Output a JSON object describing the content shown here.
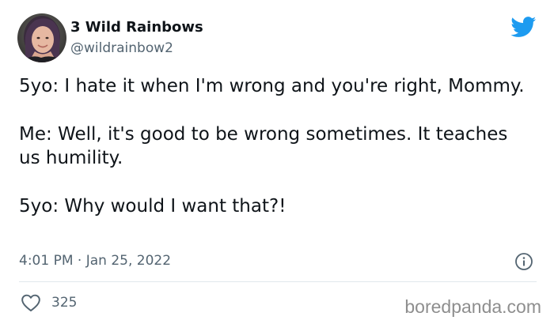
{
  "author": {
    "display_name": "3 Wild Rainbows",
    "handle": "@wildrainbow2",
    "avatar": "avatar-photo"
  },
  "platform_logo": "twitter-bird-icon",
  "tweet": {
    "lines": [
      "5yo: I hate it when I'm wrong and you're right, Mommy.",
      "Me: Well, it's good to be wrong sometimes. It teaches us humility.",
      "5yo: Why would I want that?!"
    ],
    "timestamp": "4:01 PM · Jan 25, 2022"
  },
  "engagement": {
    "likes": "325",
    "like_icon": "heart-icon",
    "info_icon": "info-icon"
  },
  "watermark": "boredpanda.com",
  "colors": {
    "text": "#0f1419",
    "secondary": "#536471",
    "twitter_blue": "#1d9bf0",
    "divider": "#e1e8ed",
    "watermark": "#8e8e8e"
  }
}
